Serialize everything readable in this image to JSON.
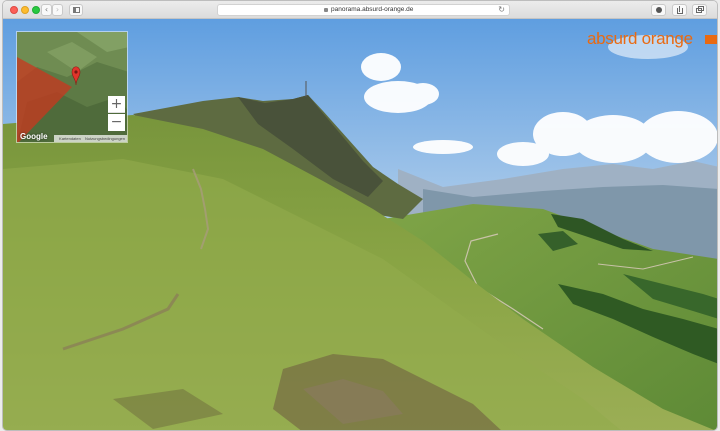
{
  "browser": {
    "address_url": "panorama.absurd-orange.de",
    "back_glyph": "‹",
    "forward_glyph": "›",
    "reload_glyph": "↻",
    "icons": [
      "lock-icon",
      "reload-icon",
      "extension-icon",
      "share-icon",
      "tabs-icon",
      "sidebar-icon"
    ]
  },
  "page": {
    "logo_text": "absurd orange",
    "logo_color": "#e96a12"
  },
  "minimap": {
    "zoom_in_label": "+",
    "zoom_out_label": "−",
    "google_label": "Google",
    "links": [
      "Kartendaten",
      "Nutzungsbedingungen"
    ],
    "marker_color": "#e0352b",
    "view_cone_color": "#c9371f"
  }
}
